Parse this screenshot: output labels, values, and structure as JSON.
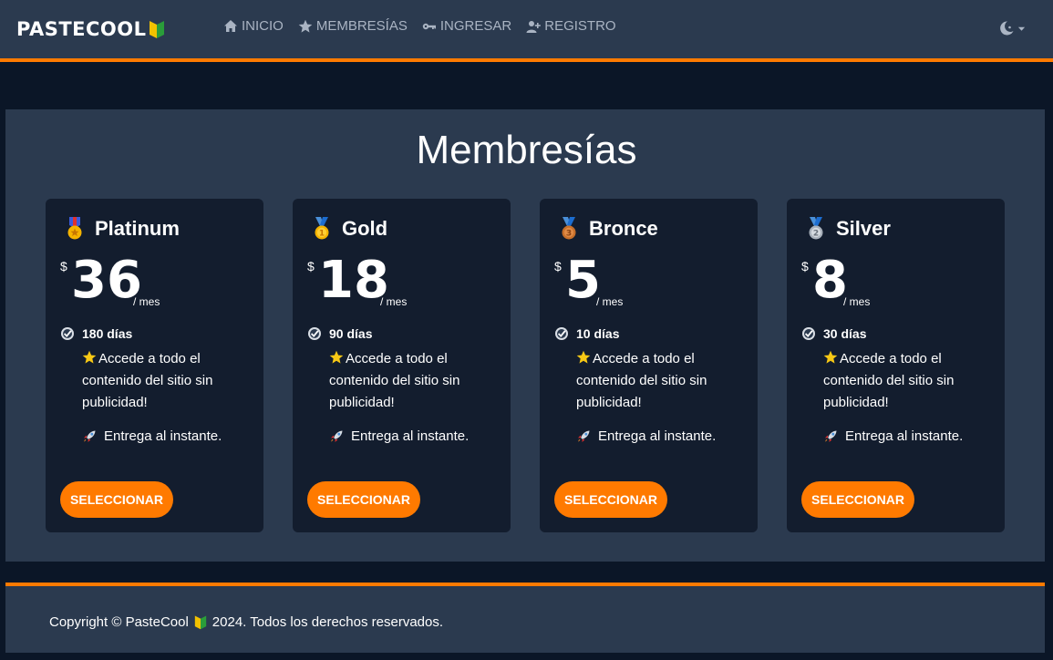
{
  "nav": {
    "brand": "PASTECOOL",
    "items": [
      {
        "label": "INICIO",
        "icon": "home-icon"
      },
      {
        "label": "MEMBRESÍAS",
        "icon": "star-icon"
      },
      {
        "label": "INGRESAR",
        "icon": "key-icon"
      },
      {
        "label": "REGISTRO",
        "icon": "user-plus-icon"
      }
    ],
    "theme_icon": "moon-icon"
  },
  "main": {
    "title": "Membresías",
    "cards": [
      {
        "name": "Platinum",
        "medal": "military-medal-icon",
        "currency": "$",
        "price": "36",
        "period": "/ mes",
        "days": "180 días",
        "feature1": "Accede a todo el contenido del sitio sin publicidad!",
        "feature2": "Entrega al instante.",
        "button": "SELECCIONAR"
      },
      {
        "name": "Gold",
        "medal": "first-place-medal-icon",
        "currency": "$",
        "price": "18",
        "period": "/ mes",
        "days": "90 días",
        "feature1": "Accede a todo el contenido del sitio sin publicidad!",
        "feature2": "Entrega al instante.",
        "button": "SELECCIONAR"
      },
      {
        "name": "Bronce",
        "medal": "third-place-medal-icon",
        "currency": "$",
        "price": "5",
        "period": "/ mes",
        "days": "10 días",
        "feature1": "Accede a todo el contenido del sitio sin publicidad!",
        "feature2": "Entrega al instante.",
        "button": "SELECCIONAR"
      },
      {
        "name": "Silver",
        "medal": "second-place-medal-icon",
        "currency": "$",
        "price": "8",
        "period": "/ mes",
        "days": "30 días",
        "feature1": "Accede a todo el contenido del sitio sin publicidad!",
        "feature2": "Entrega al instante.",
        "button": "SELECCIONAR"
      }
    ]
  },
  "footer": {
    "copyright_prefix": "Copyright © PasteCool",
    "copyright_suffix": "2024. Todos los derechos reservados."
  },
  "colors": {
    "accent": "#ff7a00",
    "navbar_bg": "#2b3a4f",
    "page_bg": "#0b1627",
    "card_bg": "#131d2e"
  }
}
